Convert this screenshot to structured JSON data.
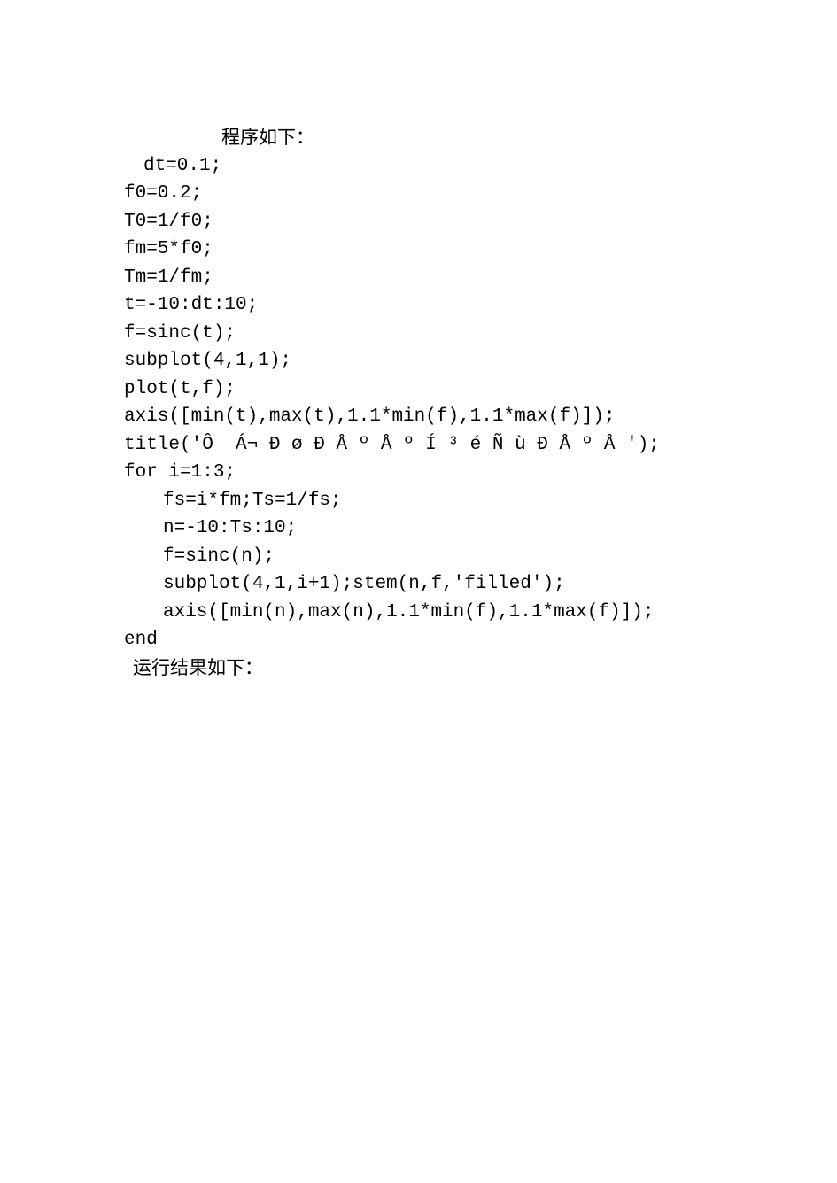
{
  "lines": {
    "l0": "程序如下：",
    "l1": "dt=0.1;",
    "l2": "f0=0.2;",
    "l3": "T0=1/f0;",
    "l4": "fm=5*f0;",
    "l5": "Tm=1/fm;",
    "l6": "t=-10:dt:10;",
    "l7": "f=sinc(t);",
    "l8": "subplot(4,1,1);",
    "l9": "plot(t,f);",
    "l10": "axis([min(t),max(t),1.1*min(f),1.1*max(f)]);",
    "l11": "title('Ô  Á¬ Ð ø Ð Å º Å º Í ³ é Ñ ù Ð Å º Å ');",
    "l12": "for i=1:3;",
    "l13": "fs=i*fm;Ts=1/fs;",
    "l14": "n=-10:Ts:10;",
    "l15": "f=sinc(n);",
    "l16": "subplot(4,1,i+1);stem(n,f,'filled');",
    "l17": "axis([min(n),max(n),1.1*min(f),1.1*max(f)]);",
    "l18": "end",
    "l19": "运行结果如下："
  }
}
